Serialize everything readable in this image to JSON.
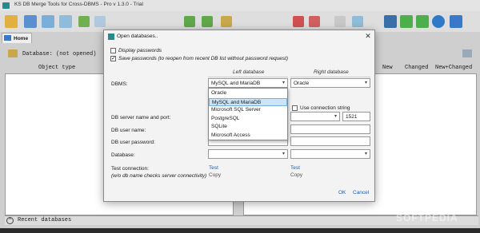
{
  "window": {
    "title": "KS DB Merge Tools for Cross-DBMS - Pro v 1.3.0 - Trial"
  },
  "tabs": [
    {
      "label": "Home"
    }
  ],
  "main": {
    "db_status": "Database: (not opened)",
    "columns": {
      "object_type": "Object type",
      "new": "New",
      "changed": "Changed",
      "new_changed": "New+Changed"
    },
    "recent_label": "Recent databases",
    "recent_toggle": "^"
  },
  "dialog": {
    "title": "Open databases..",
    "close_glyph": "✕",
    "display_passwords": {
      "label": "Display passwords",
      "checked": false
    },
    "save_passwords": {
      "label": "Save passwords (to reopen from recent DB list without password request)",
      "checked": true
    },
    "left_header": "Left database",
    "right_header": "Right database",
    "dbms_label": "DBMS:",
    "left_dbms": "MySQL and MariaDB",
    "right_dbms": "Oracle",
    "use_conn_string": "Use connection string",
    "server_label": "DB server name and port:",
    "right_port": "1521",
    "user_label": "DB user name:",
    "password_label": "DB user password:",
    "database_label": "Database:",
    "test_label": "Test connection:",
    "test_note": "(w/o db name checks server connectivity)",
    "left_test": "Test",
    "left_copy": "Copy",
    "right_test": "Test",
    "right_copy": "Copy",
    "ok": "OK",
    "cancel": "Cancel",
    "dropdown_options": [
      "Oracle",
      "MySQL and MariaDB",
      "Microsoft SQL Server",
      "PostgreSQL",
      "SQLite",
      "Microsoft Access"
    ],
    "dropdown_selected_index": 1
  },
  "watermark": "SOFTPEDIA",
  "icons": [
    "app-icon",
    "home-icon",
    "database-icon",
    "dropdown-arrow-icon",
    "close-icon",
    "help-icon"
  ],
  "colors": {
    "accent": "#1a5fb4",
    "selection": "#cce4f7",
    "app_teal": "#2a8a8a"
  }
}
